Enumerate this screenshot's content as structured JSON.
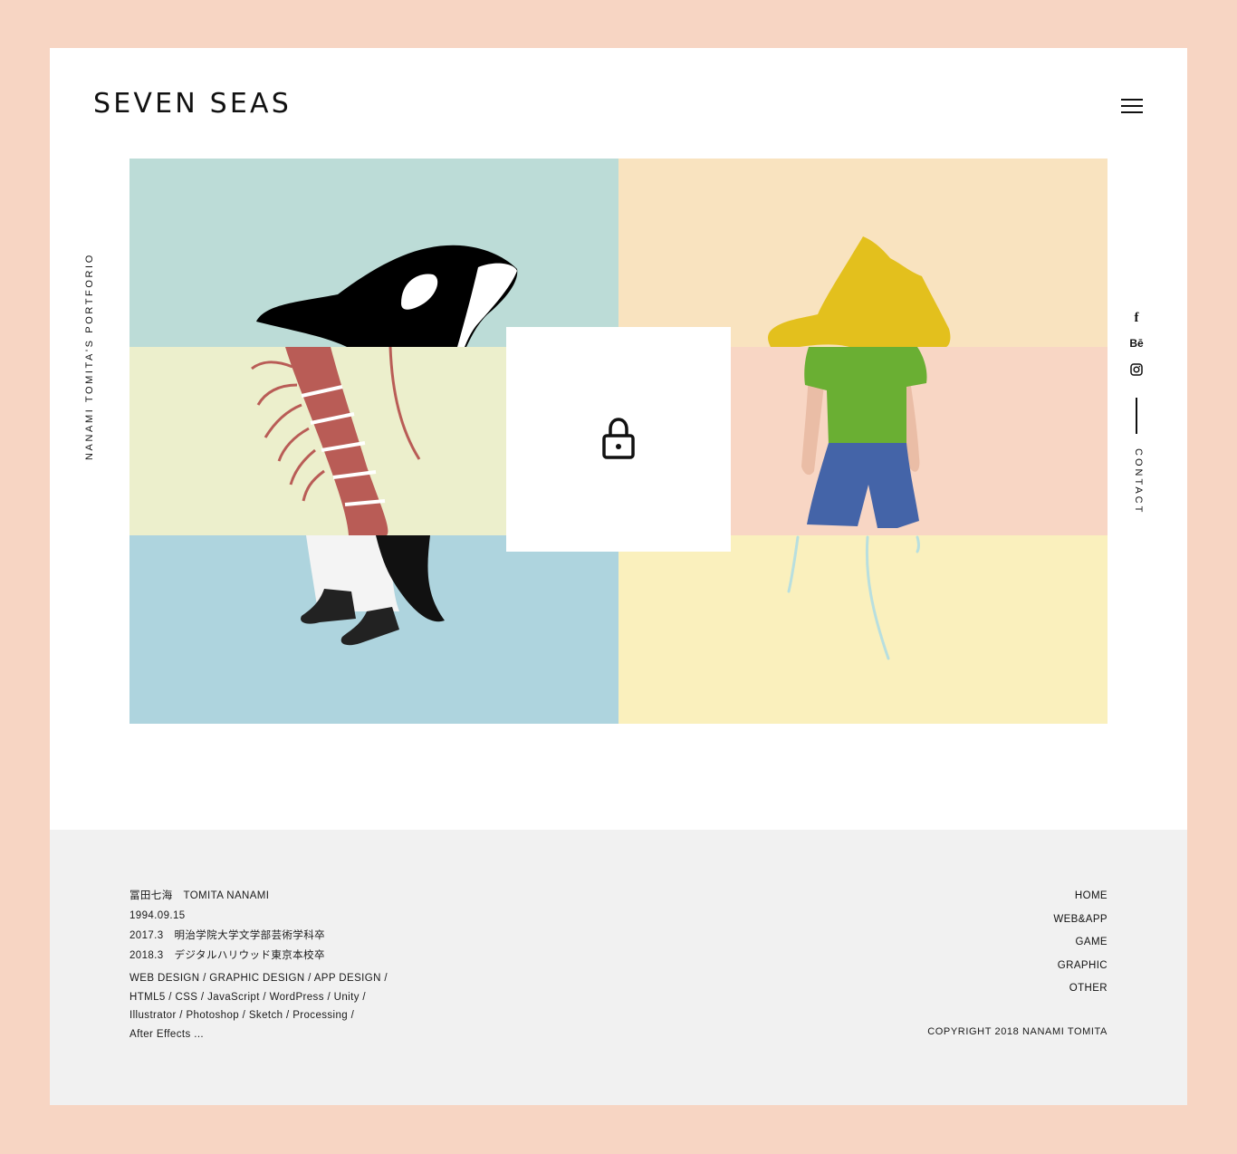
{
  "header": {
    "logo": "SEVEN SEAS",
    "menu_icon": "hamburger-menu-icon"
  },
  "side": {
    "left_text": "NANAMI TOMITA'S PORTFORIO",
    "social": [
      {
        "name": "facebook-icon",
        "glyph": "f"
      },
      {
        "name": "behance-icon",
        "glyph": "Bē"
      },
      {
        "name": "instagram-icon",
        "glyph": ""
      }
    ],
    "contact": "CONTACT"
  },
  "hero": {
    "lock_icon": "lock-icon",
    "colors": {
      "top_left": "#bcdcd7",
      "top_right": "#f9e3bf",
      "mid_left": "#ecefcc",
      "mid_right": "#f8d6c4",
      "bot_left": "#aed4de",
      "bot_right": "#faf0bd"
    }
  },
  "footer": {
    "profile": [
      "冨田七海　TOMITA NANAMI",
      "1994.09.15",
      "2017.3　明治学院大学文学部芸術学科卒",
      "2018.3　デジタルハリウッド東京本校卒"
    ],
    "skills": [
      "WEB DESIGN / GRAPHIC DESIGN / APP DESIGN /",
      "HTML5 / CSS / JavaScript / WordPress / Unity /",
      "Illustrator / Photoshop / Sketch / Processing /",
      "After Effects ..."
    ],
    "nav": [
      "HOME",
      "WEB&APP",
      "GAME",
      "GRAPHIC",
      "OTHER"
    ],
    "copyright": "COPYRIGHT 2018 NANAMI TOMITA"
  }
}
